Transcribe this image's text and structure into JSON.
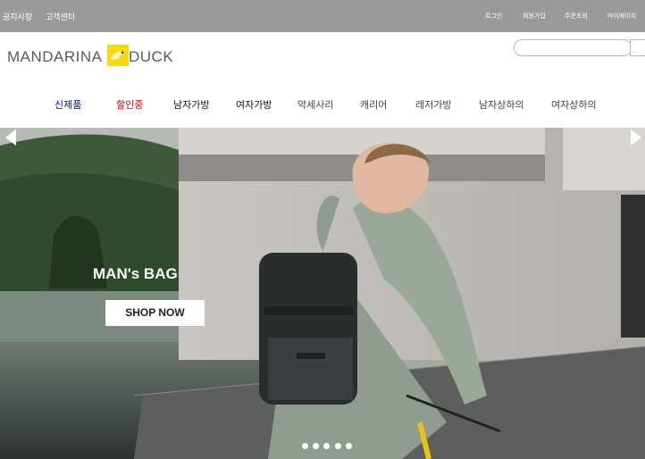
{
  "topbar": {
    "left_links": [
      "공지사항",
      "고객센터"
    ],
    "right_links": [
      "로그인",
      "회원가입",
      "주문조회",
      "마이페이지"
    ]
  },
  "logo": {
    "text_left": "MANDARINA",
    "text_right": "DUCK"
  },
  "search": {
    "value": "",
    "placeholder": ""
  },
  "nav": {
    "items": [
      {
        "label": "신제품",
        "color": "#0000cc"
      },
      {
        "label": "할인중",
        "color": "#cc0000"
      },
      {
        "label": "남자가방",
        "color": "#111111"
      },
      {
        "label": "여자가방",
        "color": "#111111"
      },
      {
        "label": "악세사리",
        "color": "#444444"
      },
      {
        "label": "캐리어",
        "color": "#444444"
      },
      {
        "label": "레저가방",
        "color": "#444444"
      },
      {
        "label": "남자상하의",
        "color": "#444444"
      },
      {
        "label": "여자상하의",
        "color": "#444444"
      }
    ]
  },
  "hero": {
    "caption": "MAN's BAG",
    "cta_label": "SHOP NOW",
    "slide_count": 5,
    "active_slide": 1
  },
  "colors": {
    "topbar": "#9a9a9a",
    "accent_logo": "#f5d90a"
  }
}
